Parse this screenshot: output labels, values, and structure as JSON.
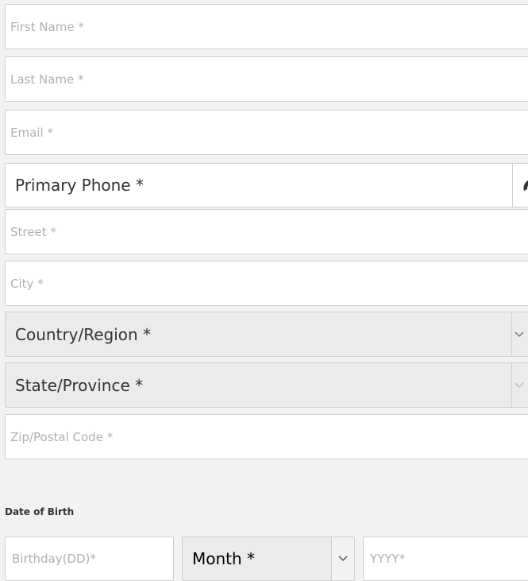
{
  "form": {
    "first_name": {
      "placeholder": "First Name *"
    },
    "last_name": {
      "placeholder": "Last Name *"
    },
    "email": {
      "placeholder": "Email *"
    },
    "primary_phone": {
      "placeholder": "Primary Phone *"
    },
    "street": {
      "placeholder": "Street *"
    },
    "city": {
      "placeholder": "City *"
    },
    "country": {
      "value": "Country/Region *"
    },
    "state": {
      "value": "State/Province *"
    },
    "zip": {
      "placeholder": "Zip/Postal Code *"
    },
    "dob": {
      "title": "Date of Birth",
      "day_placeholder": "Birthday(DD)*",
      "month_value": "Month *",
      "year_placeholder": "YYYY*"
    }
  },
  "icons": {
    "phone": "phone-icon",
    "chevron": "chevron-down-icon"
  },
  "colors": {
    "background": "#f2f2f2",
    "field_bg": "#ffffff",
    "select_bg": "#ebebeb",
    "border": "#cfcfcf",
    "placeholder": "#b0b0b0",
    "text": "#333333",
    "phone_accent": "#1e73be"
  }
}
